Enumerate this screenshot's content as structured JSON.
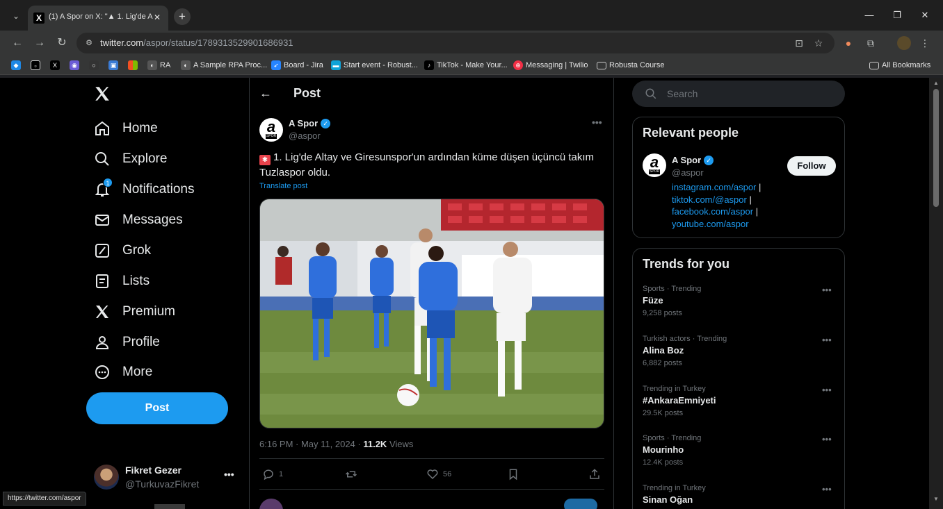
{
  "browser": {
    "tab_title": "(1) A Spor on X: \"▲ 1. Lig'de A",
    "url_host": "twitter.com",
    "url_path": "/aspor/status/1789313529901686931",
    "bookmarks": [
      "RA",
      "A Sample RPA Proc...",
      "Board - Jira",
      "Start event - Robust...",
      "TikTok - Make Your...",
      "Messaging | Twilio",
      "Robusta Course"
    ],
    "all_bookmarks": "All Bookmarks",
    "status_url": "https://twitter.com/aspor"
  },
  "nav": {
    "items": [
      {
        "label": "Home",
        "icon": "home-icon"
      },
      {
        "label": "Explore",
        "icon": "search-icon"
      },
      {
        "label": "Notifications",
        "icon": "bell-icon"
      },
      {
        "label": "Messages",
        "icon": "envelope-icon"
      },
      {
        "label": "Grok",
        "icon": "grok-icon"
      },
      {
        "label": "Lists",
        "icon": "list-icon"
      },
      {
        "label": "Premium",
        "icon": "x-icon"
      },
      {
        "label": "Profile",
        "icon": "person-icon"
      },
      {
        "label": "More",
        "icon": "more-circle-icon"
      }
    ],
    "notification_badge": "1",
    "post_button": "Post"
  },
  "account": {
    "name": "Fikret Gezer",
    "handle": "@TurkuvazFikret"
  },
  "post": {
    "header": "Post",
    "author_name": "A Spor",
    "author_handle": "@aspor",
    "avatar_letter": "a",
    "avatar_sub": "SPOR",
    "text": "1. Lig'de Altay ve Giresunspor'un ardından küme düşen üçüncü takım Tuzlaspor oldu.",
    "translate": "Translate post",
    "time": "6:16 PM · May 11, 2024 · ",
    "views_count": "11.2K",
    "views_label": " Views",
    "replies": "1",
    "likes": "56"
  },
  "sidebar": {
    "search_placeholder": "Search",
    "relevant_title": "Relevant people",
    "person": {
      "name": "A Spor",
      "handle": "@aspor",
      "follow": "Follow",
      "links": [
        "instagram.com/aspor",
        "tiktok.com/@aspor",
        "facebook.com/aspor",
        "youtube.com/aspor"
      ]
    },
    "trends_title": "Trends for you",
    "trends": [
      {
        "context": "Sports · Trending",
        "name": "Füze",
        "count": "9,258 posts"
      },
      {
        "context": "Turkish actors · Trending",
        "name": "Alina Boz",
        "count": "6,882 posts"
      },
      {
        "context": "Trending in Turkey",
        "name": "#AnkaraEmniyeti",
        "count": "29.5K posts"
      },
      {
        "context": "Sports · Trending",
        "name": "Mourinho",
        "count": "12.4K posts"
      },
      {
        "context": "Trending in Turkey",
        "name": "Sinan Oğan",
        "count": ""
      }
    ]
  },
  "colors": {
    "accent": "#1d9bf0",
    "background": "#000000",
    "border": "#2f3336",
    "muted": "#71767b"
  }
}
